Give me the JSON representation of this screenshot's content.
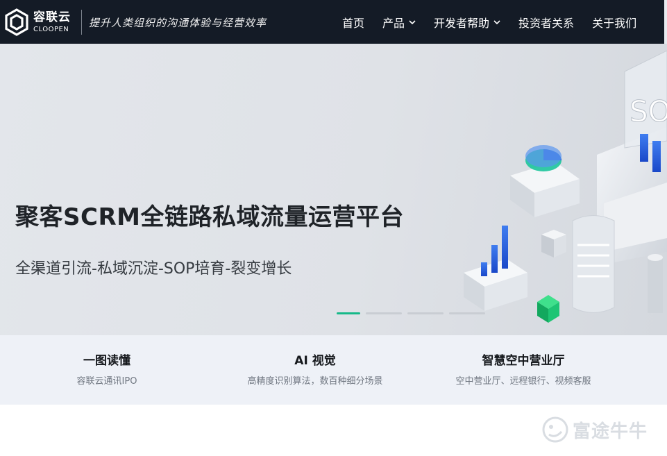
{
  "header": {
    "logo_cn": "容联云",
    "logo_en": "CLOOPEN",
    "slogan": "提升人类组织的沟通体验与经营效率",
    "nav": [
      {
        "label": "首页",
        "dropdown": false
      },
      {
        "label": "产品",
        "dropdown": true
      },
      {
        "label": "开发者帮助",
        "dropdown": true
      },
      {
        "label": "投资者关系",
        "dropdown": false
      },
      {
        "label": "关于我们",
        "dropdown": false
      }
    ]
  },
  "banner": {
    "title": "聚客SCRM全链路私域流量运营平台",
    "subtitle": "全渠道引流-私域沉淀-SOP培育-裂变增长",
    "art_text": "SO",
    "slides_total": 4,
    "slide_active": 1
  },
  "features": [
    {
      "title": "一图读懂",
      "desc": "容联云通讯IPO"
    },
    {
      "title": "AI 视觉",
      "desc": "高精度识别算法，数百种细分场景"
    },
    {
      "title": "智慧空中营业厅",
      "desc": "空中营业厅、远程银行、视频客服"
    }
  ],
  "watermark": {
    "text": "富途牛牛",
    "icon": "futu-logo-icon"
  },
  "colors": {
    "header_bg": "#141b26",
    "accent": "#16b989",
    "features_bg": "#eef1f7"
  }
}
